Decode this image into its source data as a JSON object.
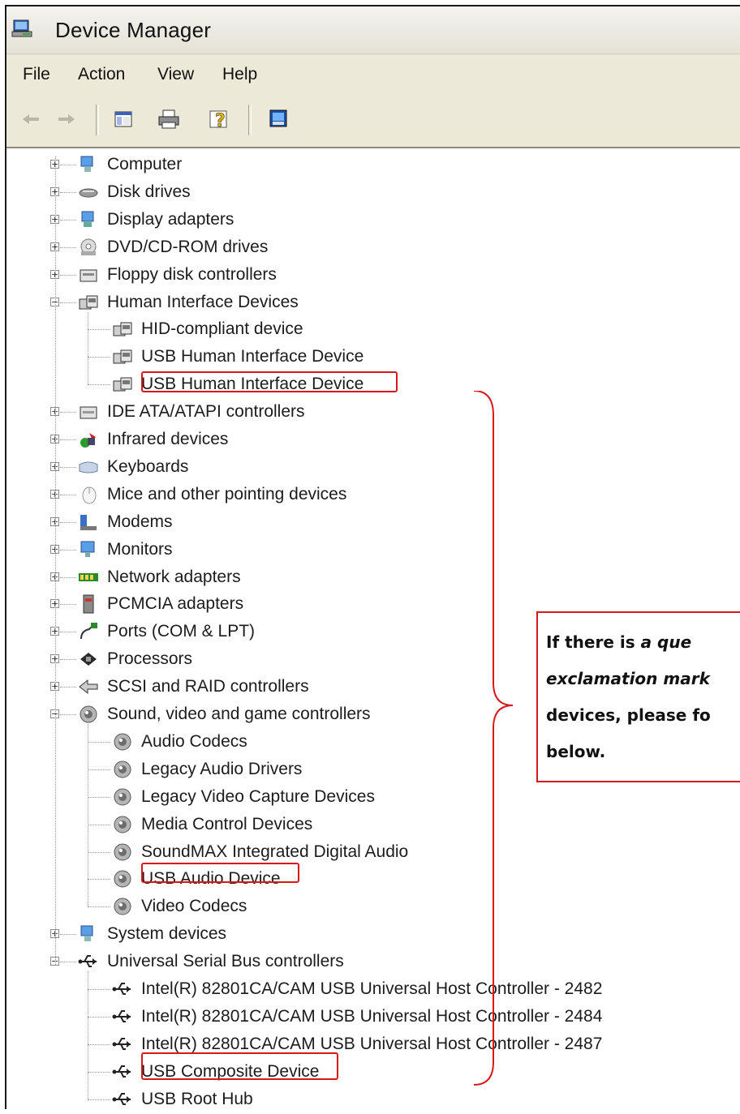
{
  "window": {
    "title": "Device Manager"
  },
  "menu": [
    "File",
    "Action",
    "View",
    "Help"
  ],
  "toolbar": {
    "buttons": [
      "back-arrow-icon",
      "forward-arrow-icon",
      "show-hide-console-tree-icon",
      "print-icon",
      "help-icon",
      "properties-icon"
    ]
  },
  "tree": {
    "items": [
      {
        "label": "Computer",
        "icon": "computer-icon",
        "level": 0,
        "expander": "+"
      },
      {
        "label": "Disk drives",
        "icon": "disk-drive-icon",
        "level": 0,
        "expander": "+"
      },
      {
        "label": "Display adapters",
        "icon": "display-adapter-icon",
        "level": 0,
        "expander": "+"
      },
      {
        "label": "DVD/CD-ROM drives",
        "icon": "cd-drive-icon",
        "level": 0,
        "expander": "+"
      },
      {
        "label": "Floppy disk controllers",
        "icon": "floppy-controller-icon",
        "level": 0,
        "expander": "+"
      },
      {
        "label": "Human Interface Devices",
        "icon": "hid-icon",
        "level": 0,
        "expander": "-"
      },
      {
        "label": "HID-compliant device",
        "icon": "hid-icon",
        "level": 1
      },
      {
        "label": "USB Human Interface Device",
        "icon": "hid-icon",
        "level": 1
      },
      {
        "label": "USB Human Interface Device",
        "icon": "hid-icon",
        "level": 1,
        "highlighted": true
      },
      {
        "label": "IDE ATA/ATAPI controllers",
        "icon": "ide-controller-icon",
        "level": 0,
        "expander": "+"
      },
      {
        "label": "Infrared devices",
        "icon": "infrared-icon",
        "level": 0,
        "expander": "+"
      },
      {
        "label": "Keyboards",
        "icon": "keyboard-icon",
        "level": 0,
        "expander": "+"
      },
      {
        "label": "Mice and other pointing devices",
        "icon": "mouse-icon",
        "level": 0,
        "expander": "+"
      },
      {
        "label": "Modems",
        "icon": "modem-icon",
        "level": 0,
        "expander": "+"
      },
      {
        "label": "Monitors",
        "icon": "monitor-icon",
        "level": 0,
        "expander": "+"
      },
      {
        "label": "Network adapters",
        "icon": "network-adapter-icon",
        "level": 0,
        "expander": "+"
      },
      {
        "label": "PCMCIA adapters",
        "icon": "pcmcia-icon",
        "level": 0,
        "expander": "+"
      },
      {
        "label": "Ports (COM & LPT)",
        "icon": "port-icon",
        "level": 0,
        "expander": "+"
      },
      {
        "label": "Processors",
        "icon": "processor-icon",
        "level": 0,
        "expander": "+"
      },
      {
        "label": "SCSI and RAID controllers",
        "icon": "scsi-icon",
        "level": 0,
        "expander": "+"
      },
      {
        "label": "Sound, video and game controllers",
        "icon": "sound-icon",
        "level": 0,
        "expander": "-"
      },
      {
        "label": "Audio Codecs",
        "icon": "sound-icon",
        "level": 1
      },
      {
        "label": "Legacy Audio Drivers",
        "icon": "sound-icon",
        "level": 1
      },
      {
        "label": "Legacy Video Capture Devices",
        "icon": "sound-icon",
        "level": 1
      },
      {
        "label": "Media Control Devices",
        "icon": "sound-icon",
        "level": 1
      },
      {
        "label": "SoundMAX Integrated Digital Audio",
        "icon": "sound-icon",
        "level": 1
      },
      {
        "label": "USB Audio Device",
        "icon": "sound-icon",
        "level": 1,
        "highlighted": true
      },
      {
        "label": "Video Codecs",
        "icon": "sound-icon",
        "level": 1
      },
      {
        "label": "System devices",
        "icon": "system-device-icon",
        "level": 0,
        "expander": "+"
      },
      {
        "label": "Universal Serial Bus controllers",
        "icon": "usb-icon",
        "level": 0,
        "expander": "-"
      },
      {
        "label": "Intel(R) 82801CA/CAM USB Universal Host Controller - 2482",
        "icon": "usb-icon",
        "level": 1
      },
      {
        "label": "Intel(R) 82801CA/CAM USB Universal Host Controller - 2484",
        "icon": "usb-icon",
        "level": 1
      },
      {
        "label": "Intel(R) 82801CA/CAM USB Universal Host Controller - 2487",
        "icon": "usb-icon",
        "level": 1
      },
      {
        "label": "USB Composite Device",
        "icon": "usb-icon",
        "level": 1,
        "highlighted": true
      },
      {
        "label": "USB Root Hub",
        "icon": "usb-icon",
        "level": 1
      }
    ]
  },
  "callout": {
    "part1": "If there is ",
    "part2": "a que",
    "line2": "exclamation mark",
    "line3": "devices, please fo",
    "line4": "below."
  },
  "colors": {
    "highlight": "#d7191c",
    "chrome": "#ece9d8"
  }
}
